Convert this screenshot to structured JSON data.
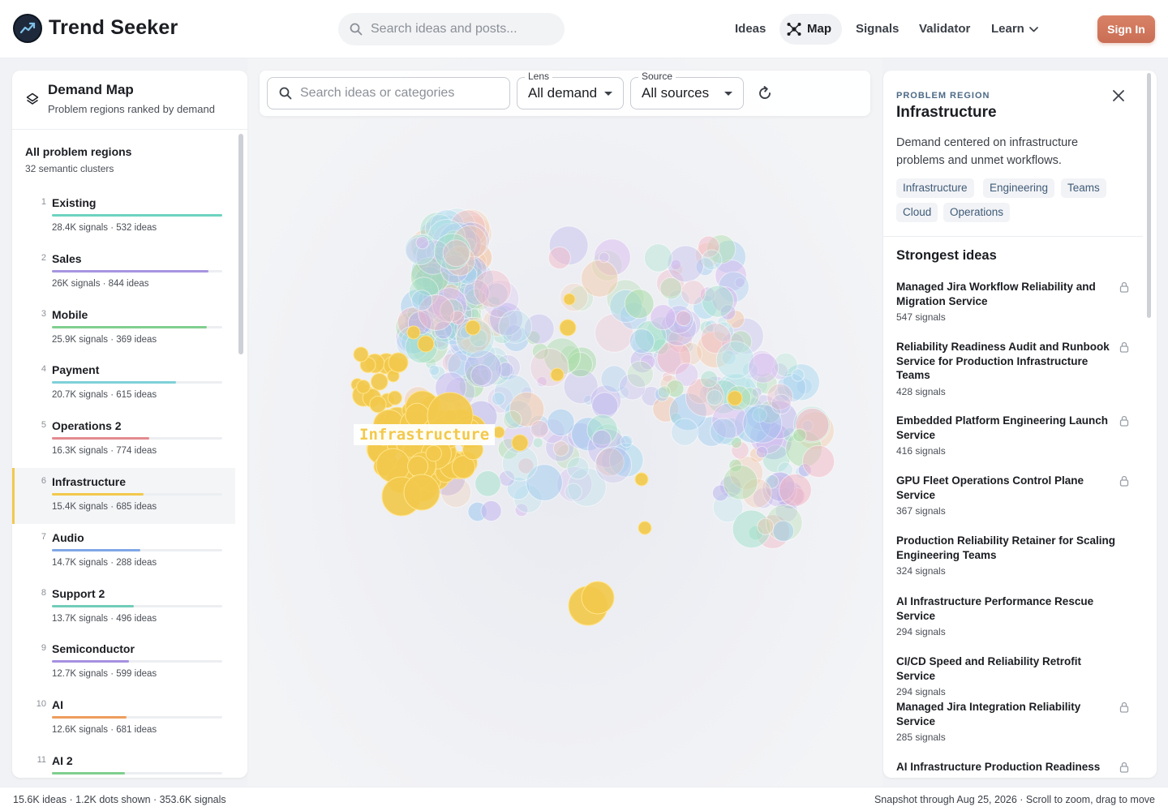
{
  "brand": {
    "name": "Trend Seeker",
    "logo_icon": "trend-chart-icon"
  },
  "header": {
    "search_placeholder": "Search ideas and posts...",
    "nav": {
      "ideas": "Ideas",
      "map": "Map",
      "signals": "Signals",
      "validator": "Validator",
      "learn": "Learn"
    },
    "sign_in": "Sign In"
  },
  "left_panel": {
    "title": "Demand Map",
    "subtitle": "Problem regions ranked by demand",
    "all_title": "All problem regions",
    "all_subtitle": "32 semantic clusters",
    "regions": [
      {
        "rank": "1",
        "name": "Existing",
        "stats": "28.4K signals · 532 ideas",
        "level": 1.0,
        "color": "#6dd3c0"
      },
      {
        "rank": "2",
        "name": "Sales",
        "stats": "26K signals · 844 ideas",
        "level": 0.92,
        "color": "#a795e0"
      },
      {
        "rank": "3",
        "name": "Mobile",
        "stats": "25.9K signals · 369 ideas",
        "level": 0.91,
        "color": "#7fcf8e"
      },
      {
        "rank": "4",
        "name": "Payment",
        "stats": "20.7K signals · 615 ideas",
        "level": 0.73,
        "color": "#7ed0d8"
      },
      {
        "rank": "5",
        "name": "Operations 2",
        "stats": "16.3K signals · 774 ideas",
        "level": 0.57,
        "color": "#e38a8f"
      },
      {
        "rank": "6",
        "name": "Infrastructure",
        "stats": "15.4K signals · 685 ideas",
        "level": 0.54,
        "color": "#f2c94c",
        "active": true
      },
      {
        "rank": "7",
        "name": "Audio",
        "stats": "14.7K signals · 288 ideas",
        "level": 0.52,
        "color": "#7fa7e6"
      },
      {
        "rank": "8",
        "name": "Support 2",
        "stats": "13.7K signals · 496 ideas",
        "level": 0.48,
        "color": "#71cdb8"
      },
      {
        "rank": "9",
        "name": "Semiconductor",
        "stats": "12.7K signals · 599 ideas",
        "level": 0.45,
        "color": "#a590e0"
      },
      {
        "rank": "10",
        "name": "AI",
        "stats": "12.6K signals · 681 ideas",
        "level": 0.44,
        "color": "#ee9d5c"
      },
      {
        "rank": "11",
        "name": "AI 2",
        "stats": "",
        "level": 0.43,
        "color": "#7fcf8e"
      }
    ]
  },
  "map": {
    "search_placeholder": "Search ideas or categories",
    "lens_label": "Lens",
    "lens_value": "All demand",
    "source_label": "Source",
    "source_value": "All sources",
    "highlight_label": "Infrastructure",
    "highlight_color": "#f2c94c"
  },
  "right_panel": {
    "kicker": "PROBLEM REGION",
    "title": "Infrastructure",
    "description": "Demand centered on infrastructure problems and unmet workflows.",
    "tags": [
      "Infrastructure",
      "Engineering",
      "Teams",
      "Cloud",
      "Operations"
    ],
    "strongest_title": "Strongest ideas",
    "ideas": [
      {
        "title": "Managed Jira Workflow Reliability and Migration Service",
        "signals": "547 signals",
        "locked": true
      },
      {
        "title": "Reliability Readiness Audit and Runbook Service for Production Infrastructure Teams",
        "signals": "428 signals",
        "locked": true
      },
      {
        "title": "Embedded Platform Engineering Launch Service",
        "signals": "416 signals",
        "locked": true
      },
      {
        "title": "GPU Fleet Operations Control Plane Service",
        "signals": "367 signals",
        "locked": true
      },
      {
        "title": "Production Reliability Retainer for Scaling Engineering Teams",
        "signals": "324 signals",
        "locked": false
      },
      {
        "title": "AI Infrastructure Performance Rescue Service",
        "signals": "294 signals",
        "locked": false
      },
      {
        "title": "CI/CD Speed and Reliability Retrofit Service",
        "signals": "294 signals",
        "locked": false
      },
      {
        "title": "Managed Jira Integration Reliability Service",
        "signals": "285 signals",
        "locked": true
      },
      {
        "title": "AI Infrastructure Production Readiness",
        "signals": "",
        "locked": true
      }
    ]
  },
  "status": {
    "left": "15.6K ideas · 1.2K dots shown · 353.6K signals",
    "right": "Snapshot through Aug 25, 2026 · Scroll to zoom, drag to move"
  }
}
